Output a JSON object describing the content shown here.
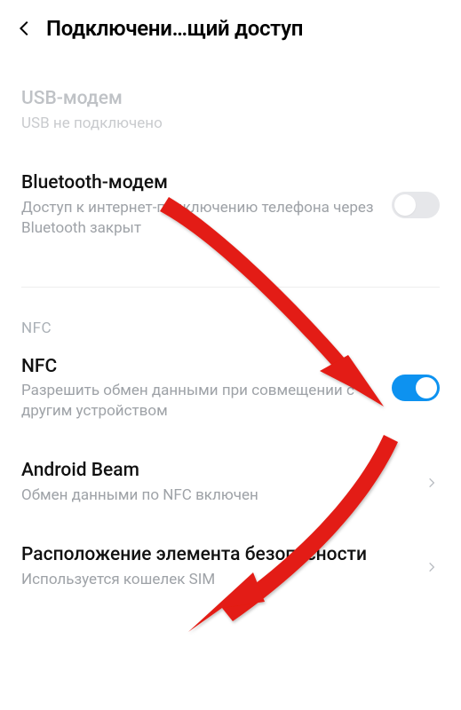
{
  "header": {
    "title": "Подключени…щий доступ"
  },
  "items": {
    "usb_modem": {
      "title": "USB-модем",
      "subtitle": "USB не подключено"
    },
    "bluetooth_modem": {
      "title": "Bluetooth-модем",
      "subtitle": "Доступ к интернет-подключению телефона через Bluetooth закрыт",
      "toggle": false
    },
    "section_nfc_label": "NFC",
    "nfc": {
      "title": "NFC",
      "subtitle": "Разрешить обмен данными при совмещении с другим устройством",
      "toggle": true
    },
    "android_beam": {
      "title": "Android Beam",
      "subtitle": "Обмен данными по NFC включен"
    },
    "security_element": {
      "title": "Расположение элемента безопасности",
      "subtitle": "Используется кошелек SIM"
    }
  },
  "colors": {
    "accent": "#0d92f0",
    "arrow": "#e31b12"
  }
}
